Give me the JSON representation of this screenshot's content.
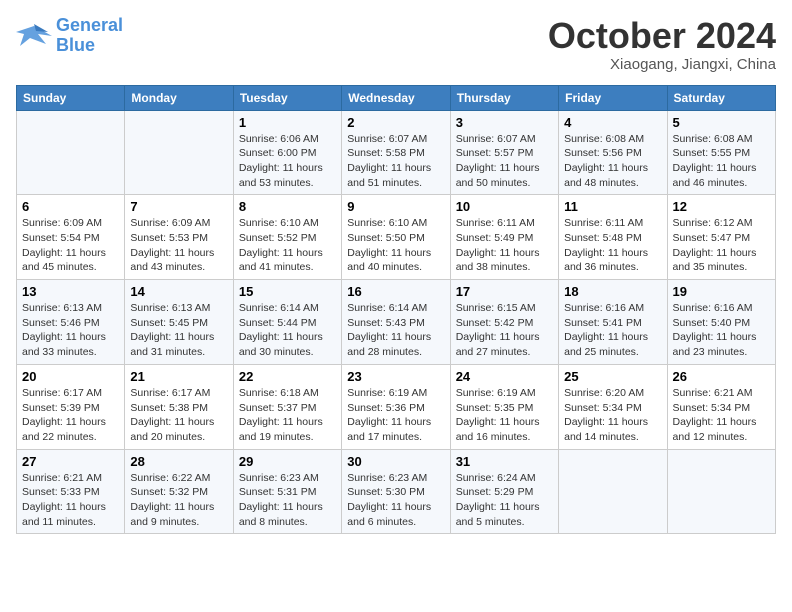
{
  "header": {
    "logo_line1": "General",
    "logo_line2": "Blue",
    "month": "October 2024",
    "location": "Xiaogang, Jiangxi, China"
  },
  "weekdays": [
    "Sunday",
    "Monday",
    "Tuesday",
    "Wednesday",
    "Thursday",
    "Friday",
    "Saturday"
  ],
  "weeks": [
    [
      {
        "day": "",
        "info": ""
      },
      {
        "day": "",
        "info": ""
      },
      {
        "day": "1",
        "info": "Sunrise: 6:06 AM\nSunset: 6:00 PM\nDaylight: 11 hours and 53 minutes."
      },
      {
        "day": "2",
        "info": "Sunrise: 6:07 AM\nSunset: 5:58 PM\nDaylight: 11 hours and 51 minutes."
      },
      {
        "day": "3",
        "info": "Sunrise: 6:07 AM\nSunset: 5:57 PM\nDaylight: 11 hours and 50 minutes."
      },
      {
        "day": "4",
        "info": "Sunrise: 6:08 AM\nSunset: 5:56 PM\nDaylight: 11 hours and 48 minutes."
      },
      {
        "day": "5",
        "info": "Sunrise: 6:08 AM\nSunset: 5:55 PM\nDaylight: 11 hours and 46 minutes."
      }
    ],
    [
      {
        "day": "6",
        "info": "Sunrise: 6:09 AM\nSunset: 5:54 PM\nDaylight: 11 hours and 45 minutes."
      },
      {
        "day": "7",
        "info": "Sunrise: 6:09 AM\nSunset: 5:53 PM\nDaylight: 11 hours and 43 minutes."
      },
      {
        "day": "8",
        "info": "Sunrise: 6:10 AM\nSunset: 5:52 PM\nDaylight: 11 hours and 41 minutes."
      },
      {
        "day": "9",
        "info": "Sunrise: 6:10 AM\nSunset: 5:50 PM\nDaylight: 11 hours and 40 minutes."
      },
      {
        "day": "10",
        "info": "Sunrise: 6:11 AM\nSunset: 5:49 PM\nDaylight: 11 hours and 38 minutes."
      },
      {
        "day": "11",
        "info": "Sunrise: 6:11 AM\nSunset: 5:48 PM\nDaylight: 11 hours and 36 minutes."
      },
      {
        "day": "12",
        "info": "Sunrise: 6:12 AM\nSunset: 5:47 PM\nDaylight: 11 hours and 35 minutes."
      }
    ],
    [
      {
        "day": "13",
        "info": "Sunrise: 6:13 AM\nSunset: 5:46 PM\nDaylight: 11 hours and 33 minutes."
      },
      {
        "day": "14",
        "info": "Sunrise: 6:13 AM\nSunset: 5:45 PM\nDaylight: 11 hours and 31 minutes."
      },
      {
        "day": "15",
        "info": "Sunrise: 6:14 AM\nSunset: 5:44 PM\nDaylight: 11 hours and 30 minutes."
      },
      {
        "day": "16",
        "info": "Sunrise: 6:14 AM\nSunset: 5:43 PM\nDaylight: 11 hours and 28 minutes."
      },
      {
        "day": "17",
        "info": "Sunrise: 6:15 AM\nSunset: 5:42 PM\nDaylight: 11 hours and 27 minutes."
      },
      {
        "day": "18",
        "info": "Sunrise: 6:16 AM\nSunset: 5:41 PM\nDaylight: 11 hours and 25 minutes."
      },
      {
        "day": "19",
        "info": "Sunrise: 6:16 AM\nSunset: 5:40 PM\nDaylight: 11 hours and 23 minutes."
      }
    ],
    [
      {
        "day": "20",
        "info": "Sunrise: 6:17 AM\nSunset: 5:39 PM\nDaylight: 11 hours and 22 minutes."
      },
      {
        "day": "21",
        "info": "Sunrise: 6:17 AM\nSunset: 5:38 PM\nDaylight: 11 hours and 20 minutes."
      },
      {
        "day": "22",
        "info": "Sunrise: 6:18 AM\nSunset: 5:37 PM\nDaylight: 11 hours and 19 minutes."
      },
      {
        "day": "23",
        "info": "Sunrise: 6:19 AM\nSunset: 5:36 PM\nDaylight: 11 hours and 17 minutes."
      },
      {
        "day": "24",
        "info": "Sunrise: 6:19 AM\nSunset: 5:35 PM\nDaylight: 11 hours and 16 minutes."
      },
      {
        "day": "25",
        "info": "Sunrise: 6:20 AM\nSunset: 5:34 PM\nDaylight: 11 hours and 14 minutes."
      },
      {
        "day": "26",
        "info": "Sunrise: 6:21 AM\nSunset: 5:34 PM\nDaylight: 11 hours and 12 minutes."
      }
    ],
    [
      {
        "day": "27",
        "info": "Sunrise: 6:21 AM\nSunset: 5:33 PM\nDaylight: 11 hours and 11 minutes."
      },
      {
        "day": "28",
        "info": "Sunrise: 6:22 AM\nSunset: 5:32 PM\nDaylight: 11 hours and 9 minutes."
      },
      {
        "day": "29",
        "info": "Sunrise: 6:23 AM\nSunset: 5:31 PM\nDaylight: 11 hours and 8 minutes."
      },
      {
        "day": "30",
        "info": "Sunrise: 6:23 AM\nSunset: 5:30 PM\nDaylight: 11 hours and 6 minutes."
      },
      {
        "day": "31",
        "info": "Sunrise: 6:24 AM\nSunset: 5:29 PM\nDaylight: 11 hours and 5 minutes."
      },
      {
        "day": "",
        "info": ""
      },
      {
        "day": "",
        "info": ""
      }
    ]
  ]
}
